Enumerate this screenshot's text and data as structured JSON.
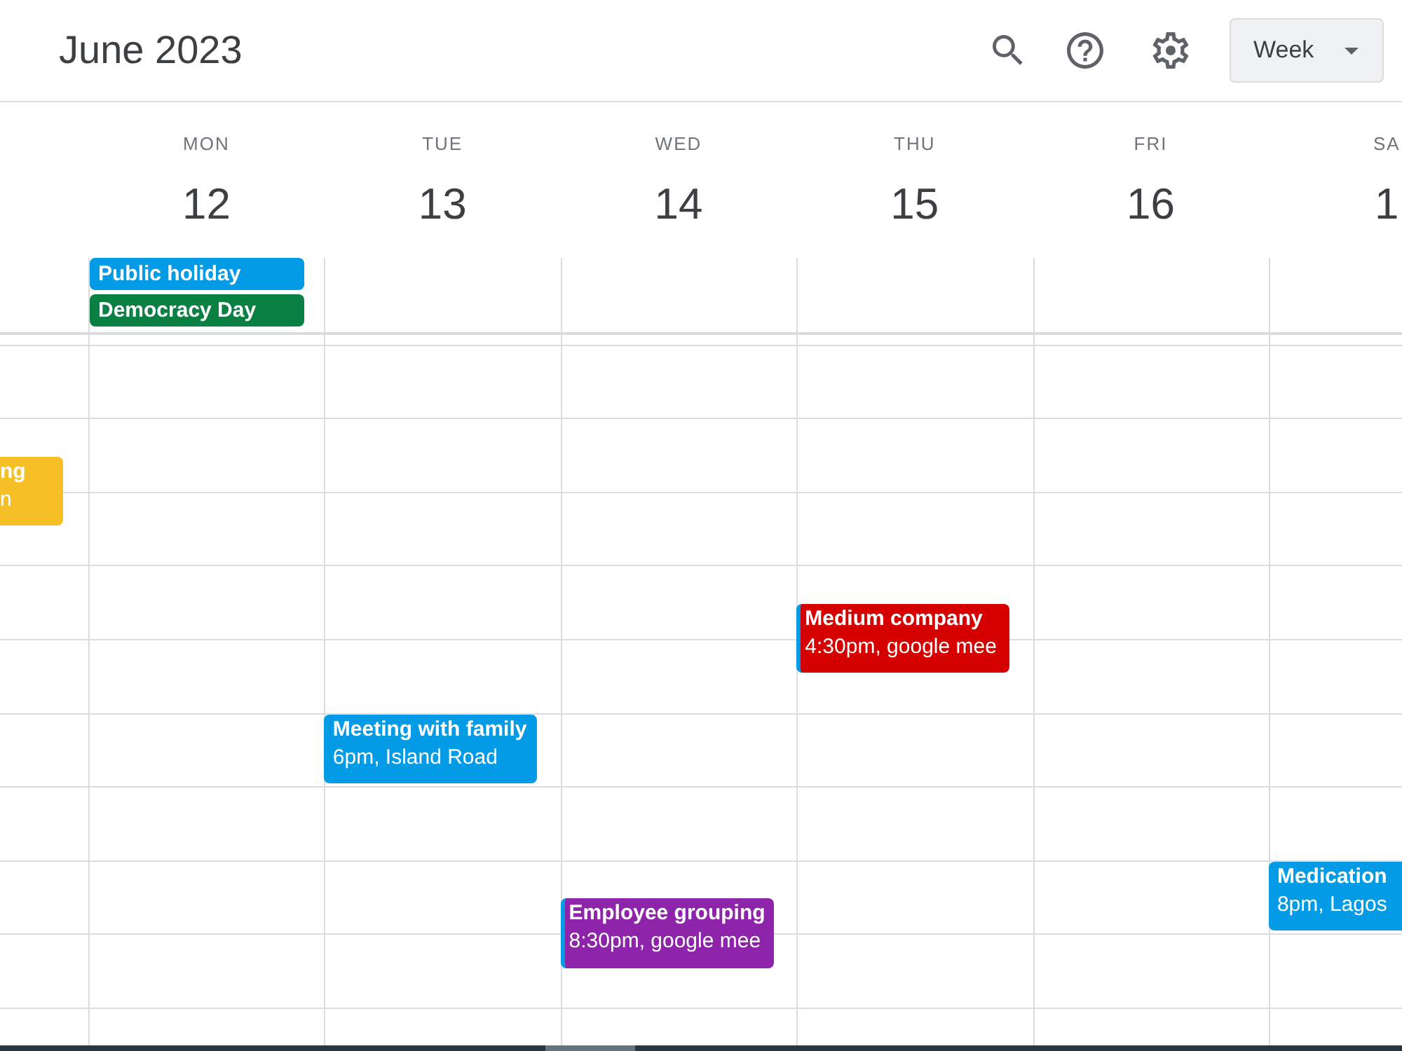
{
  "header": {
    "title": "June 2023",
    "view_button": "Week"
  },
  "days": [
    {
      "timed_events": [
        {
          "title": "ng",
          "detail": "n",
          "color": "#f6bf26"
        }
      ]
    },
    {
      "weekday": "MON",
      "date": "12",
      "all_day_events": [
        {
          "title": "Public holiday",
          "color": "#039be5"
        },
        {
          "title": "Democracy Day",
          "color": "#0b8043"
        }
      ]
    },
    {
      "weekday": "TUE",
      "date": "13",
      "timed_events": [
        {
          "title": "Meeting with family",
          "detail": "6pm, Island Road",
          "color": "#039be5"
        }
      ]
    },
    {
      "weekday": "WED",
      "date": "14",
      "timed_events": [
        {
          "title": "Employee grouping",
          "detail": "8:30pm, google mee",
          "color": "#8e24aa",
          "striped": true
        }
      ]
    },
    {
      "weekday": "THU",
      "date": "15",
      "timed_events": [
        {
          "title": "Medium company",
          "detail": "4:30pm, google mee",
          "color": "#d50000",
          "striped": true
        }
      ]
    },
    {
      "weekday": "FRI",
      "date": "16"
    },
    {
      "weekday": "SA",
      "date": "1",
      "timed_events": [
        {
          "title": "Medication",
          "detail": "8pm, Lagos",
          "color": "#039be5"
        }
      ]
    }
  ]
}
